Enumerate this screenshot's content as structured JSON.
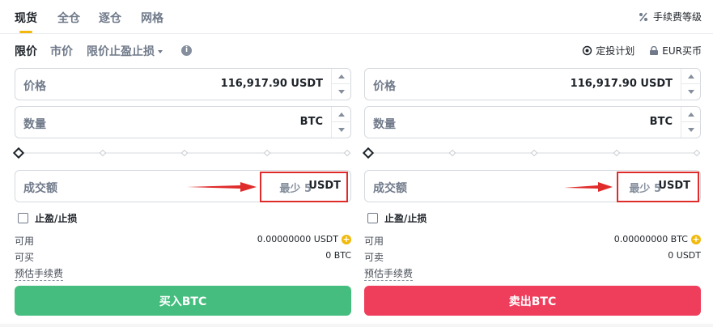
{
  "top_tabs": [
    "现货",
    "全仓",
    "逐仓",
    "网格"
  ],
  "fee_level": {
    "label": "手续费等级",
    "icon": "percent-icon"
  },
  "order_types": {
    "limit": "限价",
    "market": "市价",
    "stop_limit": "限价止盈止损"
  },
  "right_links": {
    "dca_plan": "定投计划",
    "eur_buy": "EUR买币"
  },
  "buy": {
    "price_label": "价格",
    "price_value": "116,917.90  USDT",
    "qty_label": "数量",
    "qty_value": "BTC",
    "total_label": "成交额",
    "min_text": "最少 5",
    "total_unit": "USDT",
    "tpsl_label": "止盈/止损",
    "available_label": "可用",
    "available_value": "0.00000000 USDT",
    "can_buy_label": "可买",
    "can_buy_value": "0 BTC",
    "fee_label": "预估手续费",
    "button_label": "买入BTC",
    "color": "#45bd7e"
  },
  "sell": {
    "price_label": "价格",
    "price_value": "116,917.90  USDT",
    "qty_label": "数量",
    "qty_value": "BTC",
    "total_label": "成交额",
    "min_text": "最少 5",
    "total_unit": "USDT",
    "tpsl_label": "止盈/止损",
    "available_label": "可用",
    "available_value": "0.00000000 BTC",
    "can_sell_label": "可卖",
    "can_sell_value": "0 USDT",
    "fee_label": "预估手续费",
    "button_label": "卖出BTC",
    "color": "#ef3e5c"
  },
  "colors": {
    "accent": "#f0b90b",
    "highlight_box": "#e02b2b"
  }
}
